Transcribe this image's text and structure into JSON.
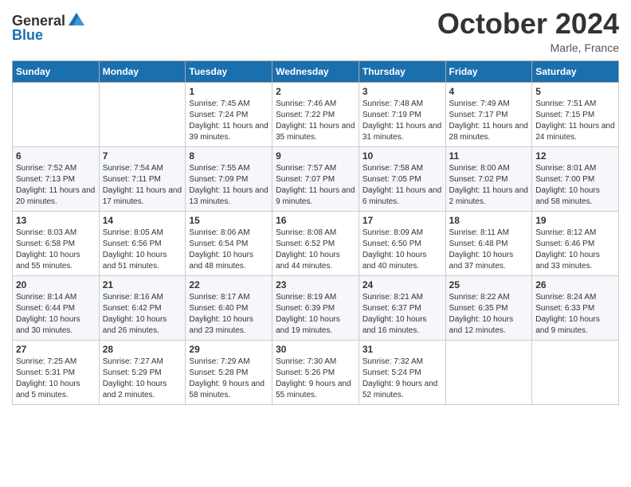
{
  "logo": {
    "general": "General",
    "blue": "Blue"
  },
  "title": "October 2024",
  "location": "Marle, France",
  "days_header": [
    "Sunday",
    "Monday",
    "Tuesday",
    "Wednesday",
    "Thursday",
    "Friday",
    "Saturday"
  ],
  "weeks": [
    [
      {
        "day": "",
        "info": ""
      },
      {
        "day": "",
        "info": ""
      },
      {
        "day": "1",
        "info": "Sunrise: 7:45 AM\nSunset: 7:24 PM\nDaylight: 11 hours and 39 minutes."
      },
      {
        "day": "2",
        "info": "Sunrise: 7:46 AM\nSunset: 7:22 PM\nDaylight: 11 hours and 35 minutes."
      },
      {
        "day": "3",
        "info": "Sunrise: 7:48 AM\nSunset: 7:19 PM\nDaylight: 11 hours and 31 minutes."
      },
      {
        "day": "4",
        "info": "Sunrise: 7:49 AM\nSunset: 7:17 PM\nDaylight: 11 hours and 28 minutes."
      },
      {
        "day": "5",
        "info": "Sunrise: 7:51 AM\nSunset: 7:15 PM\nDaylight: 11 hours and 24 minutes."
      }
    ],
    [
      {
        "day": "6",
        "info": "Sunrise: 7:52 AM\nSunset: 7:13 PM\nDaylight: 11 hours and 20 minutes."
      },
      {
        "day": "7",
        "info": "Sunrise: 7:54 AM\nSunset: 7:11 PM\nDaylight: 11 hours and 17 minutes."
      },
      {
        "day": "8",
        "info": "Sunrise: 7:55 AM\nSunset: 7:09 PM\nDaylight: 11 hours and 13 minutes."
      },
      {
        "day": "9",
        "info": "Sunrise: 7:57 AM\nSunset: 7:07 PM\nDaylight: 11 hours and 9 minutes."
      },
      {
        "day": "10",
        "info": "Sunrise: 7:58 AM\nSunset: 7:05 PM\nDaylight: 11 hours and 6 minutes."
      },
      {
        "day": "11",
        "info": "Sunrise: 8:00 AM\nSunset: 7:02 PM\nDaylight: 11 hours and 2 minutes."
      },
      {
        "day": "12",
        "info": "Sunrise: 8:01 AM\nSunset: 7:00 PM\nDaylight: 10 hours and 58 minutes."
      }
    ],
    [
      {
        "day": "13",
        "info": "Sunrise: 8:03 AM\nSunset: 6:58 PM\nDaylight: 10 hours and 55 minutes."
      },
      {
        "day": "14",
        "info": "Sunrise: 8:05 AM\nSunset: 6:56 PM\nDaylight: 10 hours and 51 minutes."
      },
      {
        "day": "15",
        "info": "Sunrise: 8:06 AM\nSunset: 6:54 PM\nDaylight: 10 hours and 48 minutes."
      },
      {
        "day": "16",
        "info": "Sunrise: 8:08 AM\nSunset: 6:52 PM\nDaylight: 10 hours and 44 minutes."
      },
      {
        "day": "17",
        "info": "Sunrise: 8:09 AM\nSunset: 6:50 PM\nDaylight: 10 hours and 40 minutes."
      },
      {
        "day": "18",
        "info": "Sunrise: 8:11 AM\nSunset: 6:48 PM\nDaylight: 10 hours and 37 minutes."
      },
      {
        "day": "19",
        "info": "Sunrise: 8:12 AM\nSunset: 6:46 PM\nDaylight: 10 hours and 33 minutes."
      }
    ],
    [
      {
        "day": "20",
        "info": "Sunrise: 8:14 AM\nSunset: 6:44 PM\nDaylight: 10 hours and 30 minutes."
      },
      {
        "day": "21",
        "info": "Sunrise: 8:16 AM\nSunset: 6:42 PM\nDaylight: 10 hours and 26 minutes."
      },
      {
        "day": "22",
        "info": "Sunrise: 8:17 AM\nSunset: 6:40 PM\nDaylight: 10 hours and 23 minutes."
      },
      {
        "day": "23",
        "info": "Sunrise: 8:19 AM\nSunset: 6:39 PM\nDaylight: 10 hours and 19 minutes."
      },
      {
        "day": "24",
        "info": "Sunrise: 8:21 AM\nSunset: 6:37 PM\nDaylight: 10 hours and 16 minutes."
      },
      {
        "day": "25",
        "info": "Sunrise: 8:22 AM\nSunset: 6:35 PM\nDaylight: 10 hours and 12 minutes."
      },
      {
        "day": "26",
        "info": "Sunrise: 8:24 AM\nSunset: 6:33 PM\nDaylight: 10 hours and 9 minutes."
      }
    ],
    [
      {
        "day": "27",
        "info": "Sunrise: 7:25 AM\nSunset: 5:31 PM\nDaylight: 10 hours and 5 minutes."
      },
      {
        "day": "28",
        "info": "Sunrise: 7:27 AM\nSunset: 5:29 PM\nDaylight: 10 hours and 2 minutes."
      },
      {
        "day": "29",
        "info": "Sunrise: 7:29 AM\nSunset: 5:28 PM\nDaylight: 9 hours and 58 minutes."
      },
      {
        "day": "30",
        "info": "Sunrise: 7:30 AM\nSunset: 5:26 PM\nDaylight: 9 hours and 55 minutes."
      },
      {
        "day": "31",
        "info": "Sunrise: 7:32 AM\nSunset: 5:24 PM\nDaylight: 9 hours and 52 minutes."
      },
      {
        "day": "",
        "info": ""
      },
      {
        "day": "",
        "info": ""
      }
    ]
  ]
}
